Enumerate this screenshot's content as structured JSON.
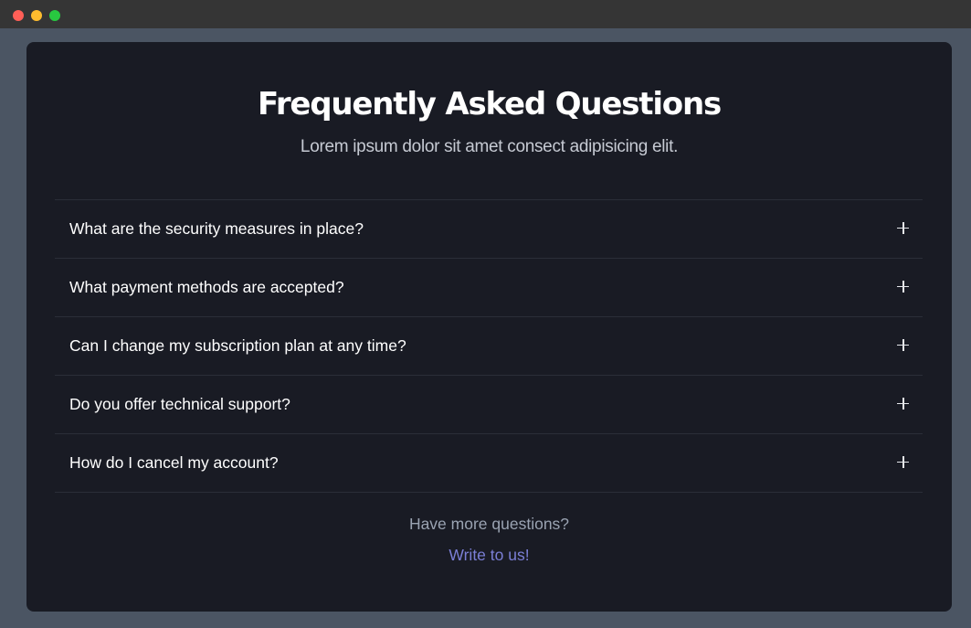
{
  "window": {
    "controls": [
      "close",
      "minimize",
      "maximize"
    ]
  },
  "faq": {
    "title": "Frequently Asked Questions",
    "subtitle": "Lorem ipsum dolor sit amet consect adipisicing elit.",
    "items": [
      {
        "question": "What are the security measures in place?",
        "icon": "plus-icon"
      },
      {
        "question": "What payment methods are accepted?",
        "icon": "plus-icon"
      },
      {
        "question": "Can I change my subscription plan at any time?",
        "icon": "plus-icon"
      },
      {
        "question": "Do you offer technical support?",
        "icon": "plus-icon"
      },
      {
        "question": "How do I cancel my account?",
        "icon": "plus-icon"
      }
    ],
    "more_questions": "Have more questions?",
    "contact_link": "Write to us!"
  },
  "colors": {
    "background": "#4b5563",
    "card": "#191b24",
    "link": "#7b7fd6"
  }
}
